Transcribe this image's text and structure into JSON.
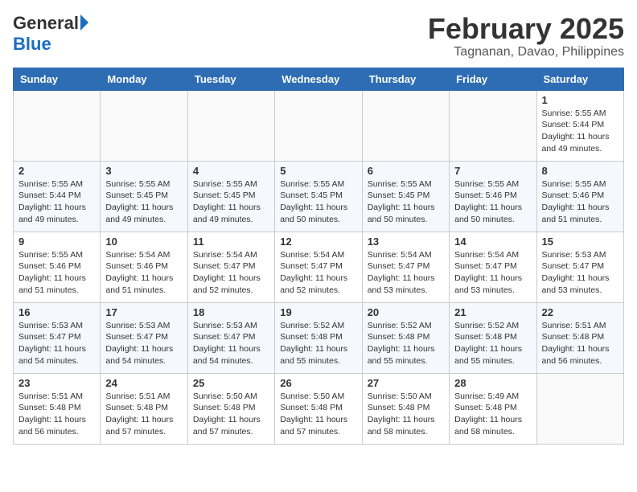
{
  "header": {
    "logo_general": "General",
    "logo_blue": "Blue",
    "month_title": "February 2025",
    "location": "Tagnanan, Davao, Philippines"
  },
  "weekdays": [
    "Sunday",
    "Monday",
    "Tuesday",
    "Wednesday",
    "Thursday",
    "Friday",
    "Saturday"
  ],
  "weeks": [
    [
      {
        "day": "",
        "info": ""
      },
      {
        "day": "",
        "info": ""
      },
      {
        "day": "",
        "info": ""
      },
      {
        "day": "",
        "info": ""
      },
      {
        "day": "",
        "info": ""
      },
      {
        "day": "",
        "info": ""
      },
      {
        "day": "1",
        "info": "Sunrise: 5:55 AM\nSunset: 5:44 PM\nDaylight: 11 hours\nand 49 minutes."
      }
    ],
    [
      {
        "day": "2",
        "info": "Sunrise: 5:55 AM\nSunset: 5:44 PM\nDaylight: 11 hours\nand 49 minutes."
      },
      {
        "day": "3",
        "info": "Sunrise: 5:55 AM\nSunset: 5:45 PM\nDaylight: 11 hours\nand 49 minutes."
      },
      {
        "day": "4",
        "info": "Sunrise: 5:55 AM\nSunset: 5:45 PM\nDaylight: 11 hours\nand 49 minutes."
      },
      {
        "day": "5",
        "info": "Sunrise: 5:55 AM\nSunset: 5:45 PM\nDaylight: 11 hours\nand 50 minutes."
      },
      {
        "day": "6",
        "info": "Sunrise: 5:55 AM\nSunset: 5:45 PM\nDaylight: 11 hours\nand 50 minutes."
      },
      {
        "day": "7",
        "info": "Sunrise: 5:55 AM\nSunset: 5:46 PM\nDaylight: 11 hours\nand 50 minutes."
      },
      {
        "day": "8",
        "info": "Sunrise: 5:55 AM\nSunset: 5:46 PM\nDaylight: 11 hours\nand 51 minutes."
      }
    ],
    [
      {
        "day": "9",
        "info": "Sunrise: 5:55 AM\nSunset: 5:46 PM\nDaylight: 11 hours\nand 51 minutes."
      },
      {
        "day": "10",
        "info": "Sunrise: 5:54 AM\nSunset: 5:46 PM\nDaylight: 11 hours\nand 51 minutes."
      },
      {
        "day": "11",
        "info": "Sunrise: 5:54 AM\nSunset: 5:47 PM\nDaylight: 11 hours\nand 52 minutes."
      },
      {
        "day": "12",
        "info": "Sunrise: 5:54 AM\nSunset: 5:47 PM\nDaylight: 11 hours\nand 52 minutes."
      },
      {
        "day": "13",
        "info": "Sunrise: 5:54 AM\nSunset: 5:47 PM\nDaylight: 11 hours\nand 53 minutes."
      },
      {
        "day": "14",
        "info": "Sunrise: 5:54 AM\nSunset: 5:47 PM\nDaylight: 11 hours\nand 53 minutes."
      },
      {
        "day": "15",
        "info": "Sunrise: 5:53 AM\nSunset: 5:47 PM\nDaylight: 11 hours\nand 53 minutes."
      }
    ],
    [
      {
        "day": "16",
        "info": "Sunrise: 5:53 AM\nSunset: 5:47 PM\nDaylight: 11 hours\nand 54 minutes."
      },
      {
        "day": "17",
        "info": "Sunrise: 5:53 AM\nSunset: 5:47 PM\nDaylight: 11 hours\nand 54 minutes."
      },
      {
        "day": "18",
        "info": "Sunrise: 5:53 AM\nSunset: 5:47 PM\nDaylight: 11 hours\nand 54 minutes."
      },
      {
        "day": "19",
        "info": "Sunrise: 5:52 AM\nSunset: 5:48 PM\nDaylight: 11 hours\nand 55 minutes."
      },
      {
        "day": "20",
        "info": "Sunrise: 5:52 AM\nSunset: 5:48 PM\nDaylight: 11 hours\nand 55 minutes."
      },
      {
        "day": "21",
        "info": "Sunrise: 5:52 AM\nSunset: 5:48 PM\nDaylight: 11 hours\nand 55 minutes."
      },
      {
        "day": "22",
        "info": "Sunrise: 5:51 AM\nSunset: 5:48 PM\nDaylight: 11 hours\nand 56 minutes."
      }
    ],
    [
      {
        "day": "23",
        "info": "Sunrise: 5:51 AM\nSunset: 5:48 PM\nDaylight: 11 hours\nand 56 minutes."
      },
      {
        "day": "24",
        "info": "Sunrise: 5:51 AM\nSunset: 5:48 PM\nDaylight: 11 hours\nand 57 minutes."
      },
      {
        "day": "25",
        "info": "Sunrise: 5:50 AM\nSunset: 5:48 PM\nDaylight: 11 hours\nand 57 minutes."
      },
      {
        "day": "26",
        "info": "Sunrise: 5:50 AM\nSunset: 5:48 PM\nDaylight: 11 hours\nand 57 minutes."
      },
      {
        "day": "27",
        "info": "Sunrise: 5:50 AM\nSunset: 5:48 PM\nDaylight: 11 hours\nand 58 minutes."
      },
      {
        "day": "28",
        "info": "Sunrise: 5:49 AM\nSunset: 5:48 PM\nDaylight: 11 hours\nand 58 minutes."
      },
      {
        "day": "",
        "info": ""
      }
    ]
  ]
}
